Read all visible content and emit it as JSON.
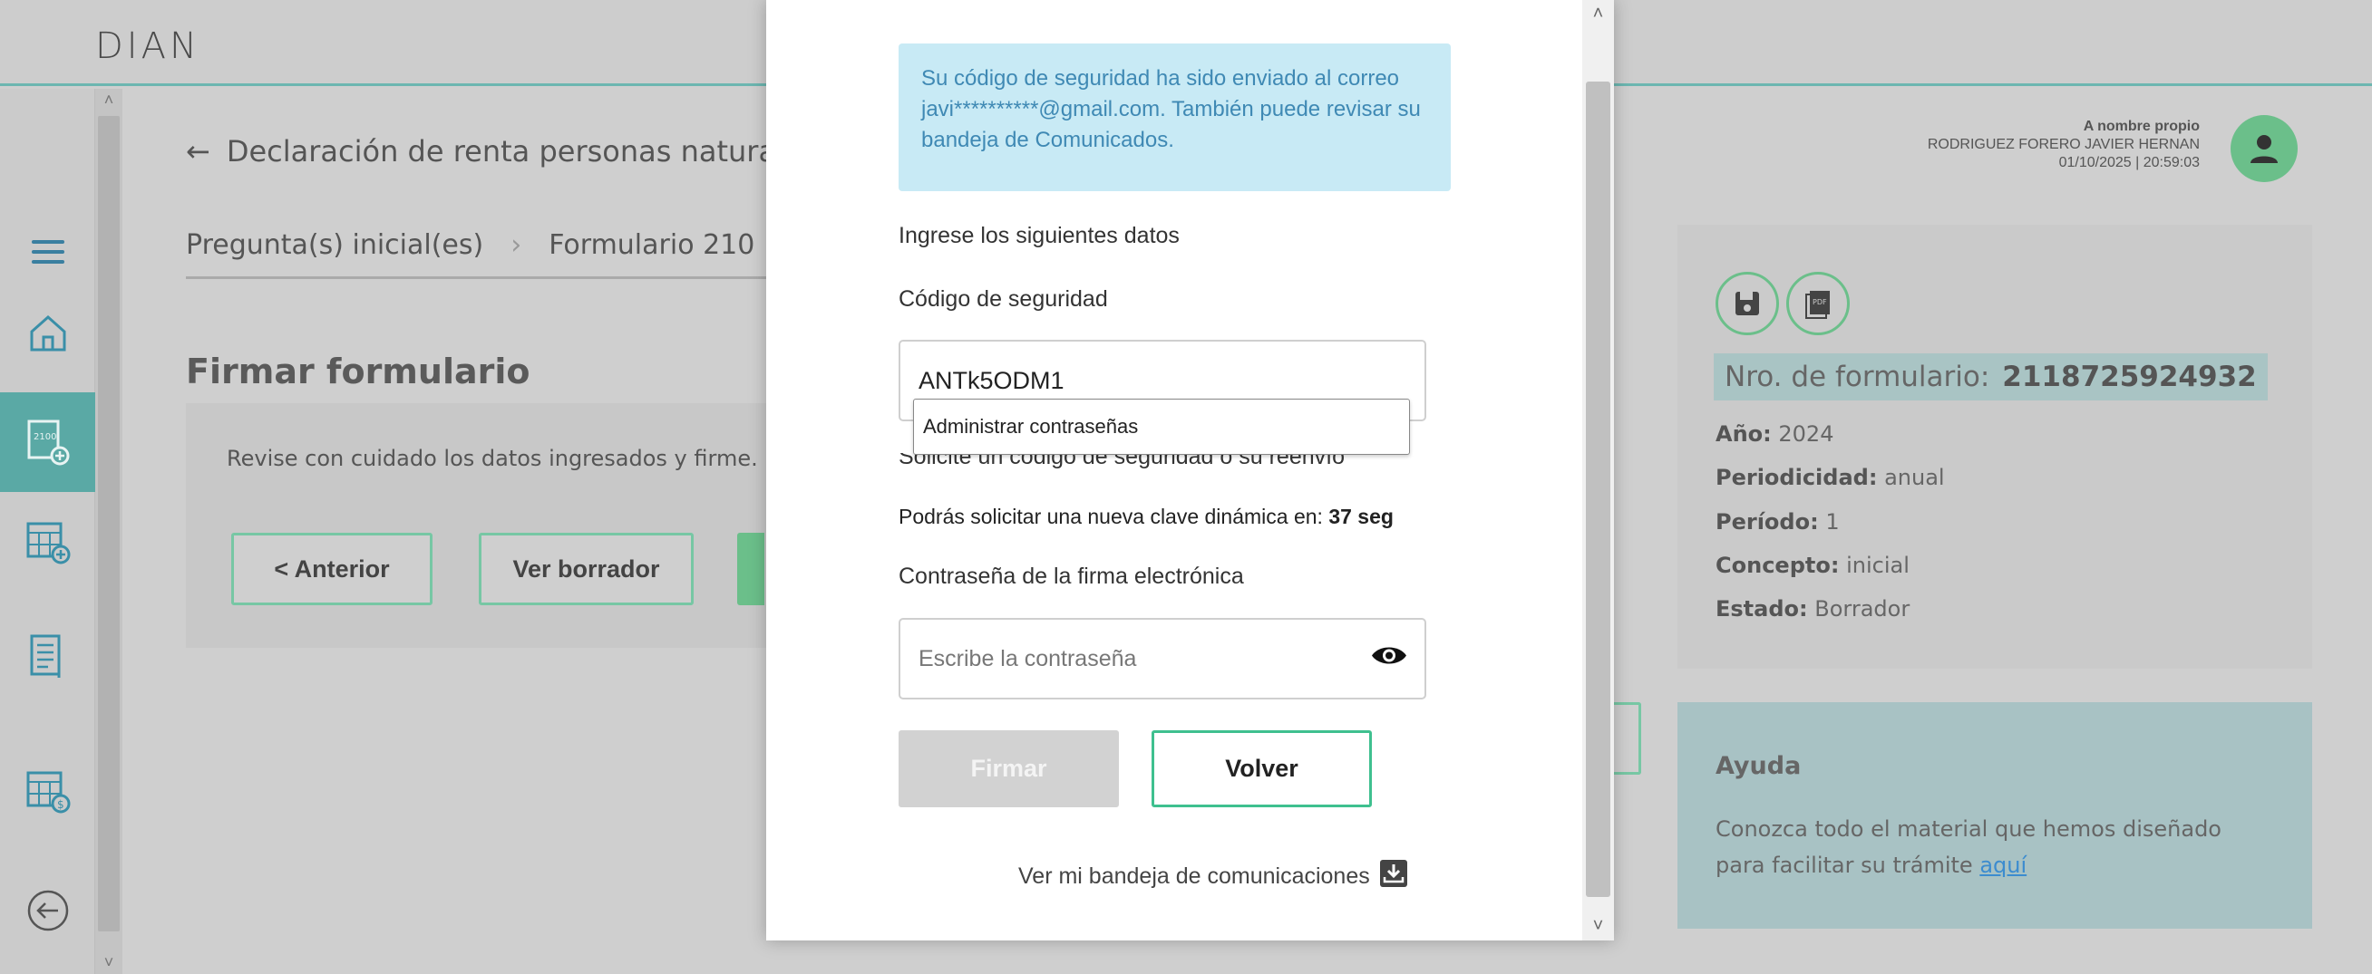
{
  "app": {
    "logo": "DIAN"
  },
  "header": {
    "back_title": "Declaración de renta personas naturales /",
    "user_role": "A nombre propio",
    "user_name": "RODRIGUEZ FORERO JAVIER HERNAN",
    "user_datetime": "01/10/2025 | 20:59:03"
  },
  "steps": {
    "step1": "Pregunta(s) inicial(es)",
    "step2": "Formulario 210"
  },
  "main": {
    "title": "Firmar formulario",
    "instruction": "Revise con cuidado los datos ingresados y firme.",
    "prev_label": "< Anterior",
    "draft_label": "Ver borrador"
  },
  "info": {
    "form_number_label": "Nro. de formulario:",
    "form_number": "2118725924932",
    "year_label": "Año:",
    "year": "2024",
    "periodicity_label": "Periodicidad:",
    "periodicity": "anual",
    "period_label": "Período:",
    "period": "1",
    "concept_label": "Concepto:",
    "concept": "inicial",
    "status_label": "Estado:",
    "status": "Borrador"
  },
  "help": {
    "title": "Ayuda",
    "text": "Conozca todo el material que hemos diseñado para facilitar su trámite",
    "link": "aquí"
  },
  "modal": {
    "alert": "Su código de seguridad ha sido enviado al correo javi**********@gmail.com. También puede revisar su bandeja de Comunicados.",
    "enter_data": "Ingrese los siguientes datos",
    "code_label": "Código de seguridad",
    "code_value": "ANTk5ODM1",
    "autofill": "Administrar contraseñas",
    "request_code": "Solicite un código de seguridad o su reenvío",
    "timer_text": "Podrás solicitar una nueva clave dinámica en:",
    "timer_value": "37 seg",
    "password_label": "Contraseña de la firma electrónica",
    "password_placeholder": "Escribe la contraseña",
    "sign_label": "Firmar",
    "back_label": "Volver",
    "inbox_link": "Ver mi bandeja de comunicaciones"
  },
  "colors": {
    "accent": "#3fc08f",
    "alert_bg": "#c8eaf5",
    "alert_text": "#3f89b4"
  }
}
